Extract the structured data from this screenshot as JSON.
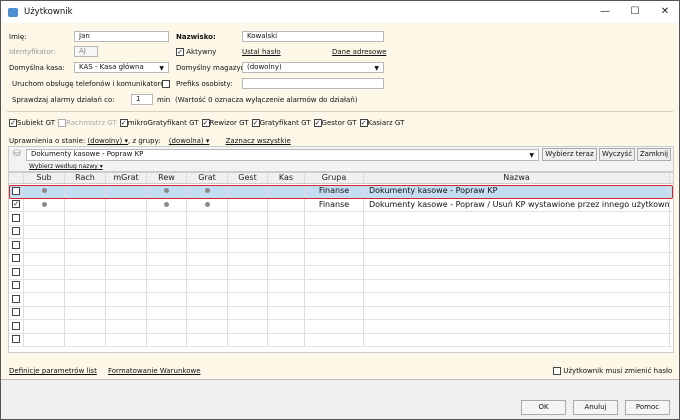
{
  "window": {
    "title": "Użytkownik",
    "minimize": "—",
    "maximize": "☐",
    "close": "✕"
  },
  "form": {
    "imie_label": "Imię:",
    "imie_value": "Jan",
    "nazwisko_label": "Nazwisko:",
    "nazwisko_value": "Kowalski",
    "identyfikator_label": "Identyfikator:",
    "identyfikator_value": "AJ",
    "aktywny_label": "Aktywny",
    "aktywny_checked": true,
    "ustal_haslo": "Ustal hasło",
    "dane_adresowe": "Dane adresowe",
    "kasa_label": "Domyślna kasa:",
    "kasa_value": "KAS - Kasa główna",
    "magazyn_label": "Domyślny magazyn:",
    "magazyn_value": "(dowolny)",
    "uruchom_label": "Uruchom obsługę telefonów i komunikatorów",
    "prefiks_label": "Prefiks osobisty:",
    "prefiks_value": "",
    "alarmy_label": "Sprawdzaj alarmy działań co:",
    "alarmy_value": "1",
    "alarmy_unit": "min",
    "alarmy_hint": "(Wartość 0 oznacza wyłączenie alarmów do działań)"
  },
  "apps": [
    {
      "label": "Subiekt GT",
      "checked": true,
      "disabled": false
    },
    {
      "label": "Rachmistrz GT",
      "checked": false,
      "disabled": true
    },
    {
      "label": "mikroGratyfikant GT",
      "checked": true,
      "disabled": false
    },
    {
      "label": "Rewizor GT",
      "checked": true,
      "disabled": false
    },
    {
      "label": "Gratyfikant GT",
      "checked": true,
      "disabled": false
    },
    {
      "label": "Gestor GT",
      "checked": true,
      "disabled": false
    },
    {
      "label": "Kasiarz GT",
      "checked": true,
      "disabled": false
    }
  ],
  "filter": {
    "stan_label": "Uprawnienia o stanie:",
    "stan_value": "(dowolny)",
    "grupy_label": ", z grupy:",
    "grupy_value": "(dowolna)",
    "zaznacz": "Zaznacz wszystkie",
    "search_value": "Dokumenty kasowe - Popraw KP",
    "wybierz_teraz": "Wybierz teraz",
    "wyczysc": "Wyczyść",
    "zamknij": "Zamknij",
    "wybierz_wg": "Wybierz według nazwy"
  },
  "grid": {
    "columns": [
      "Sub",
      "Rach",
      "mGrat",
      "Rew",
      "Grat",
      "Gest",
      "Kas",
      "Grupa",
      "Nazwa"
    ],
    "rows": [
      {
        "checked": false,
        "selected": true,
        "dots": [
          true,
          false,
          false,
          true,
          true,
          false,
          false
        ],
        "grupa": "Finanse",
        "nazwa": "Dokumenty kasowe - Popraw KP"
      },
      {
        "checked": true,
        "selected": false,
        "dots": [
          true,
          false,
          false,
          true,
          true,
          false,
          false
        ],
        "grupa": "Finanse",
        "nazwa": "Dokumenty kasowe - Popraw / Usuń KP wystawione przez innego użytkownika"
      }
    ],
    "empty_rows": 10
  },
  "bottom": {
    "definicje": "Definicje parametrów list",
    "formatowanie": "Formatowanie Warunkowe",
    "musi_zmienic": "Użytkownik musi zmienić hasło"
  },
  "footer": {
    "ok": "OK",
    "anuluj": "Anuluj",
    "pomoc": "Pomoc"
  }
}
